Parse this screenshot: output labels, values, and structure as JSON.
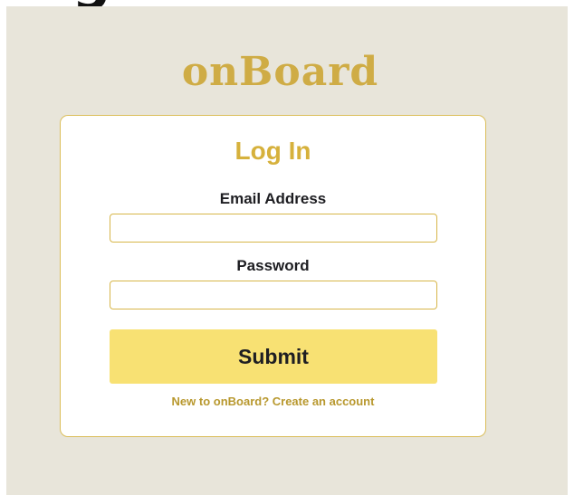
{
  "heading_fragment": "Log In",
  "brand": {
    "logo_text": "onBoard",
    "color": "#cfac45"
  },
  "login_form": {
    "title": "Log In",
    "email_label": "Email Address",
    "email_value": "",
    "password_label": "Password",
    "password_value": "",
    "submit_label": "Submit",
    "signup_link": "New to onBoard? Create an account"
  },
  "colors": {
    "background": "#e8e5da",
    "accent": "#d6b13c",
    "button": "#f8e173",
    "text": "#1e1e22"
  }
}
